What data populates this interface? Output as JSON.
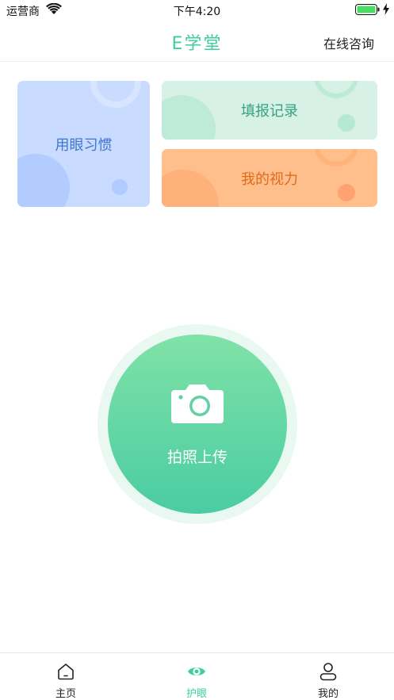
{
  "status_bar": {
    "carrier": "运营商",
    "time": "下午4:20",
    "battery_color": "#4cd964"
  },
  "header": {
    "title": "E学堂",
    "consult_label": "在线咨询",
    "title_color": "#3fcea0"
  },
  "cards": {
    "habit_label": "用眼习惯",
    "record_label": "填报记录",
    "vision_label": "我的视力"
  },
  "upload": {
    "label": "拍照上传",
    "icon": "camera-icon"
  },
  "tab_bar": {
    "items": [
      {
        "label": "主页",
        "icon": "home-icon",
        "active": false
      },
      {
        "label": "护眼",
        "icon": "eye-icon",
        "active": true
      },
      {
        "label": "我的",
        "icon": "user-icon",
        "active": false
      }
    ],
    "active_color": "#3fcea0"
  }
}
